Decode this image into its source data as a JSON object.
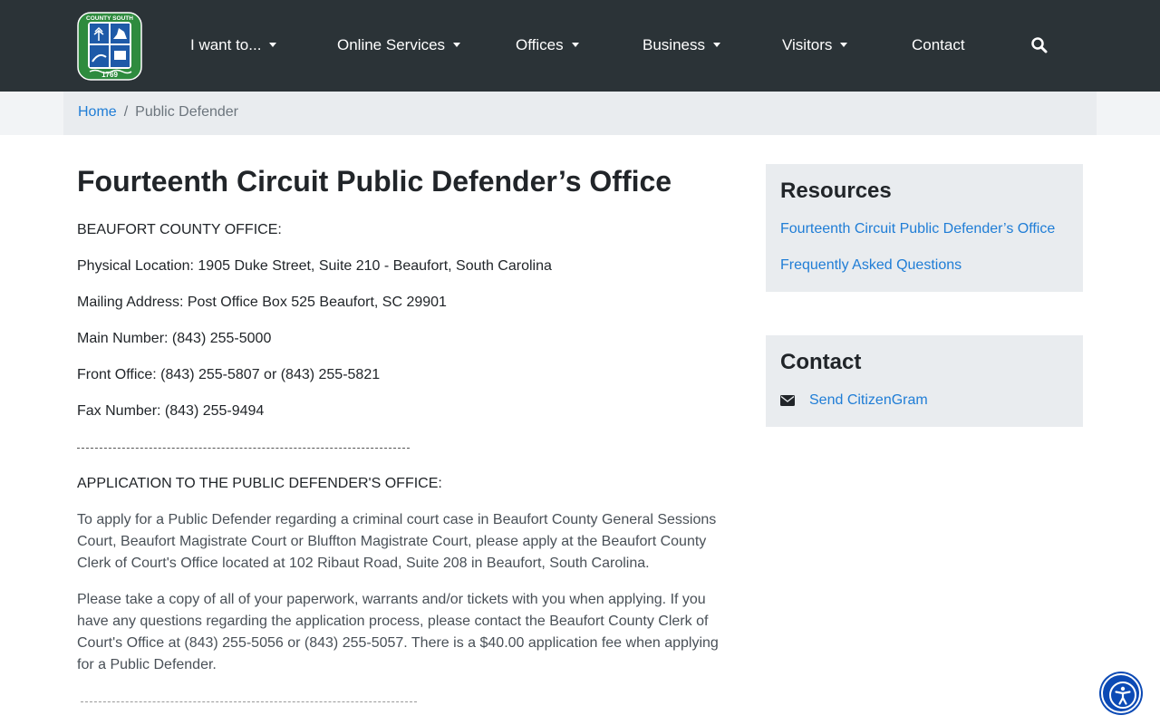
{
  "colors": {
    "navbar_bg": "#2b3337",
    "link": "#1f7dd6",
    "breadcrumb_bg": "#e9ecef",
    "card_bg": "#e9ecef",
    "accessibility_button": "#0c4ab5"
  },
  "header": {
    "logo_icon": "beaufort-county-seal",
    "nav": [
      {
        "label": "I want to...",
        "dropdown": true
      },
      {
        "label": "Online Services",
        "dropdown": true
      },
      {
        "label": "Offices",
        "dropdown": true
      },
      {
        "label": "Business",
        "dropdown": true
      },
      {
        "label": "Visitors",
        "dropdown": true
      },
      {
        "label": "Contact",
        "dropdown": false
      }
    ],
    "search_icon": "search-icon"
  },
  "breadcrumb": {
    "home": "Home",
    "separator": "/",
    "current": "Public Defender"
  },
  "main": {
    "title": "Fourteenth Circuit Public Defender’s Office",
    "office_heading": "BEAUFORT COUNTY OFFICE:",
    "physical_location": "Physical Location: 1905 Duke Street, Suite 210 - Beaufort, South Carolina",
    "mailing_address": "Mailing Address: Post Office Box 525 Beaufort, SC 29901",
    "main_number": "Main Number: (843) 255-5000",
    "front_office": "Front Office: (843) 255-5807 or (843) 255-5821",
    "fax_number": "Fax Number: (843) 255-9494",
    "application_heading": "APPLICATION TO THE PUBLIC DEFENDER'S OFFICE:",
    "paragraph_1": "To apply for a Public Defender regarding a criminal court case in Beaufort County General Sessions Court, Beaufort Magistrate Court or Bluffton Magistrate Court, please apply at the Beaufort County Clerk of Court's Office located at 102 Ribaut Road, Suite 208 in Beaufort, South Carolina.",
    "paragraph_2": "Please take a copy of all of your paperwork, warrants and/or tickets with you when applying. If you have any questions regarding the application process, please contact the Beaufort County Clerk of Court's Office at (843) 255-5056 or (843) 255-5057. There is a $40.00 application fee when applying for a Public Defender."
  },
  "sidebar": {
    "resources": {
      "title": "Resources",
      "links": [
        "Fourteenth Circuit Public Defender’s Office",
        "Frequently Asked Questions"
      ]
    },
    "contact": {
      "title": "Contact",
      "icon": "envelope-icon",
      "link": "Send CitizenGram"
    }
  },
  "accessibility": {
    "icon": "accessibility-icon"
  }
}
